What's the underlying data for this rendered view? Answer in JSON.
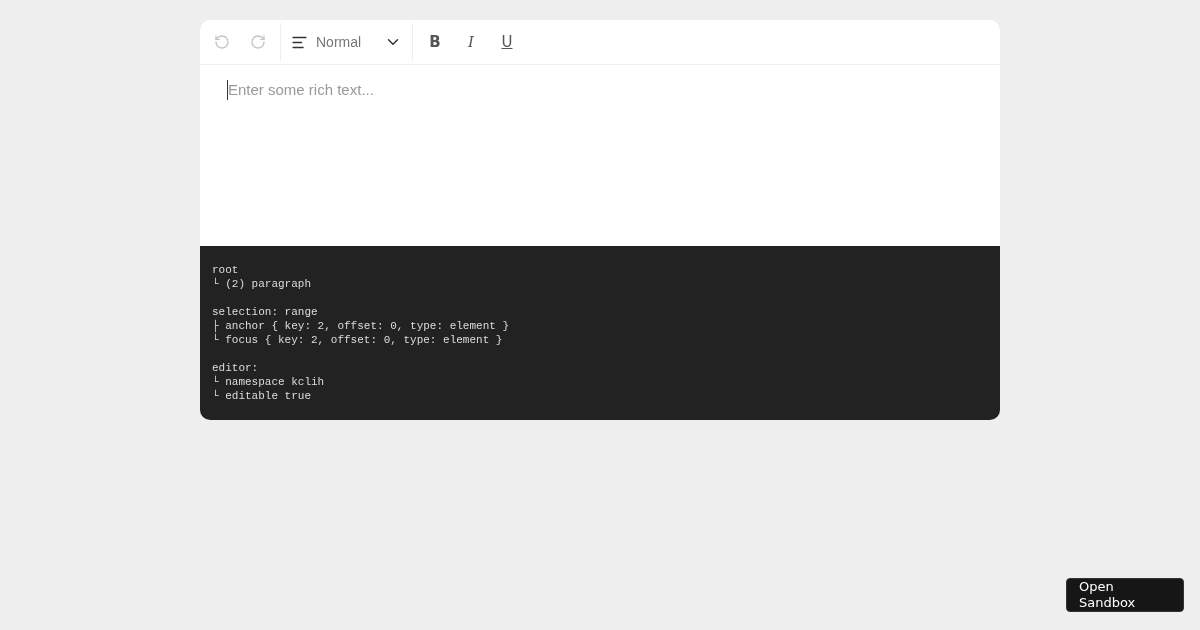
{
  "toolbar": {
    "history": [
      {
        "kind": "undo",
        "disabled": true
      },
      {
        "kind": "redo",
        "disabled": true
      }
    ],
    "block_type": {
      "label": "Normal"
    },
    "format_buttons": [
      {
        "kind": "bold",
        "label": "B"
      },
      {
        "kind": "italic",
        "label": "I"
      },
      {
        "kind": "underline",
        "label": "U"
      }
    ]
  },
  "editor": {
    "placeholder": "Enter some rich text..."
  },
  "tree_view": [
    [
      "root",
      "└ (2) paragraph"
    ],
    [
      "selection: range",
      "├ anchor { key: 2, offset: 0, type: element }",
      "└ focus { key: 2, offset: 0, type: element }"
    ],
    [
      "editor:",
      "└ namespace kclih",
      "└ editable true"
    ]
  ],
  "open_sandbox": {
    "label": "Open Sandbox"
  }
}
